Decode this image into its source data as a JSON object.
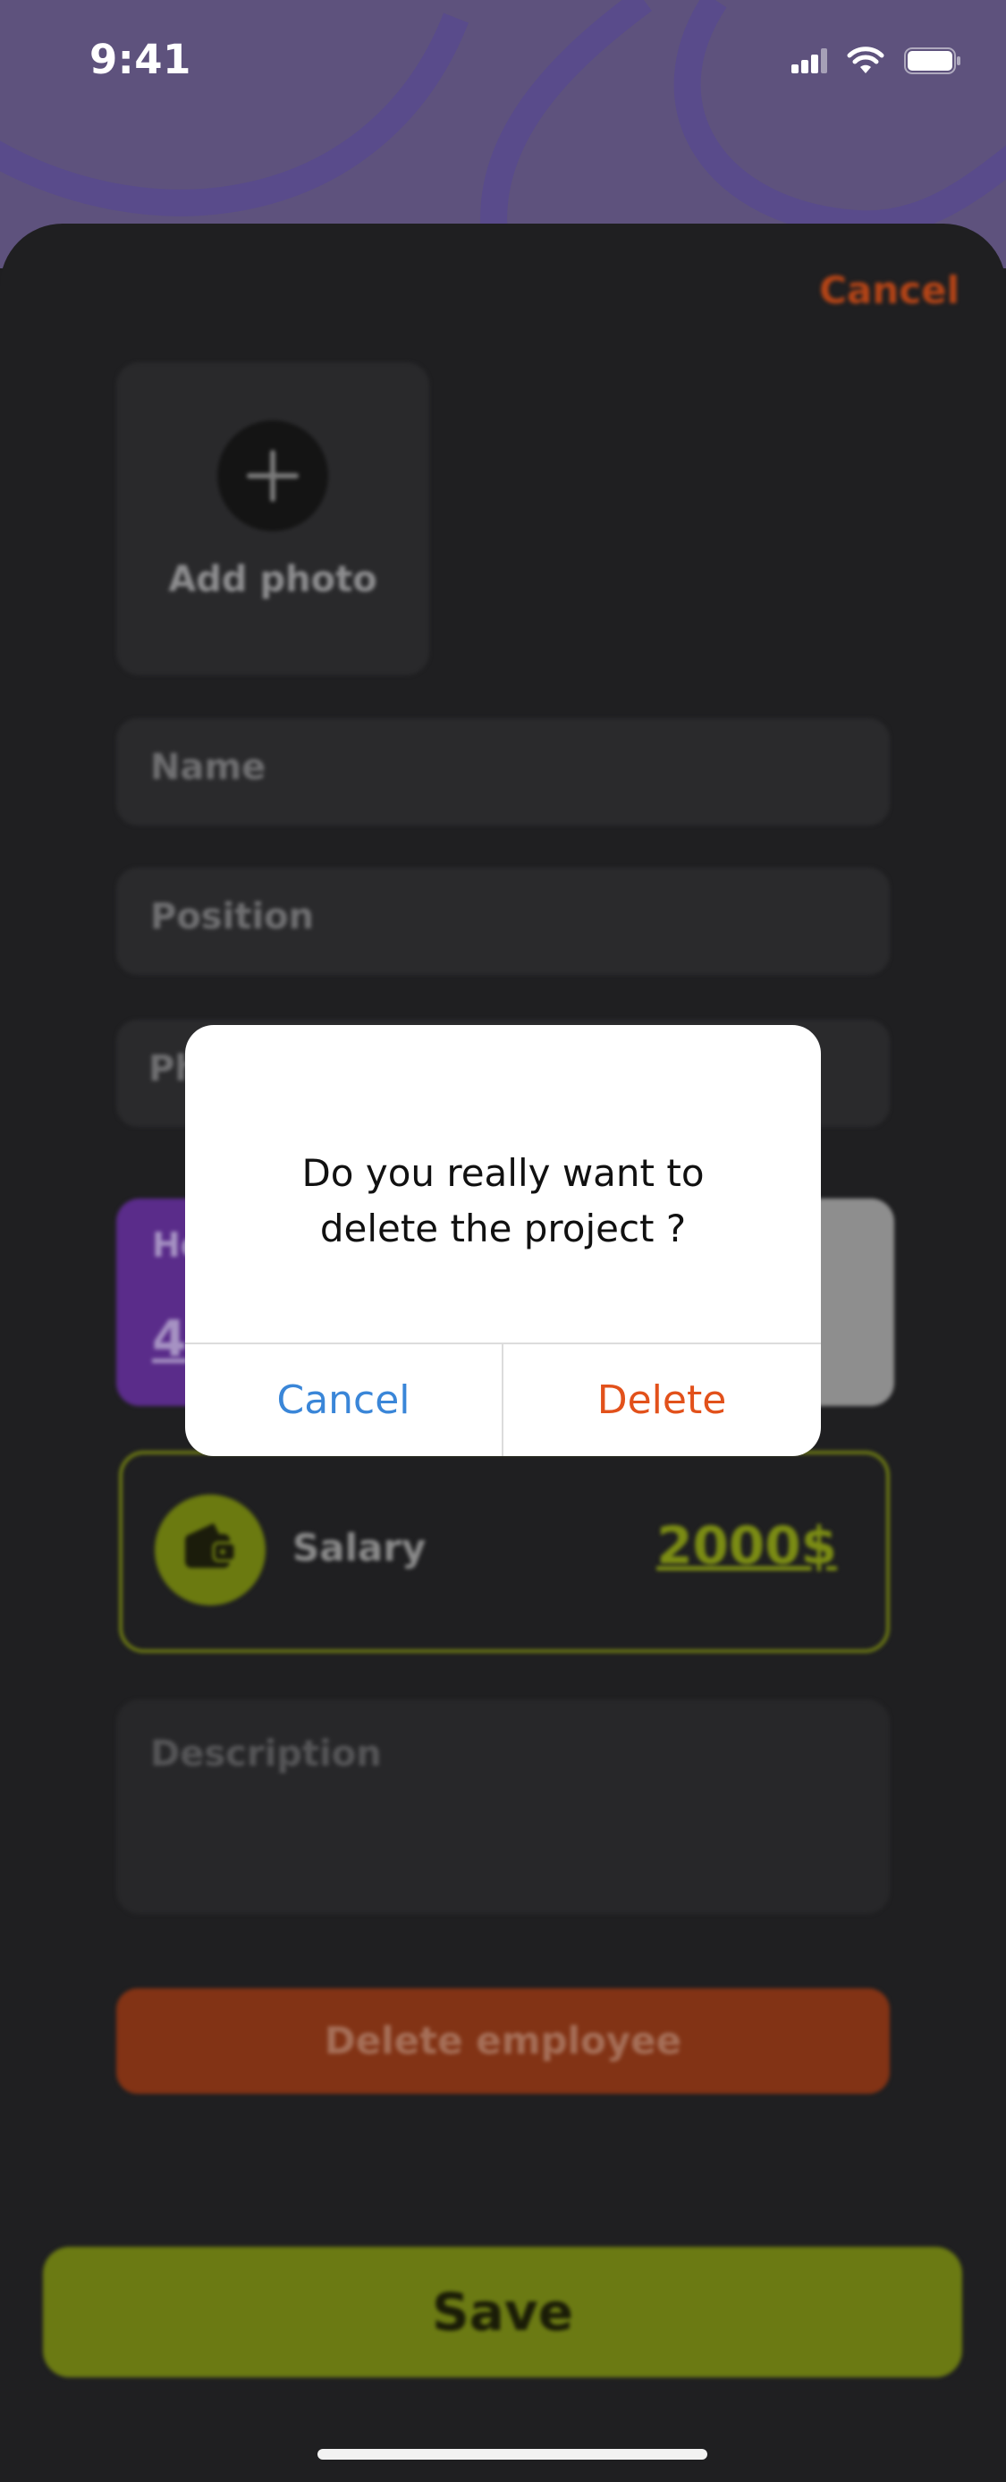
{
  "status_bar": {
    "time": "9:41"
  },
  "header": {
    "cancel_label": "Cancel"
  },
  "form": {
    "add_photo_label": "Add photo",
    "name_placeholder": "Name",
    "position_placeholder": "Position",
    "phone_placeholder": "Ph",
    "hours_label": "He",
    "hours_value": "4",
    "salary_label": "Salary",
    "salary_value": "2000$",
    "description_placeholder": "Description",
    "delete_employee_label": "Delete employee",
    "save_label": "Save"
  },
  "dialog": {
    "message_line1": "Do you really want to",
    "message_line2": "delete the project ?",
    "cancel_label": "Cancel",
    "delete_label": "Delete"
  },
  "colors": {
    "accent_green": "#6b7a13",
    "accent_orange": "#e2511b",
    "accent_blue": "#3a86d8",
    "accent_purple": "#5a2c8a",
    "header_bg": "#5e527d"
  },
  "icons": [
    "plus-icon",
    "wallet-icon",
    "signal-icon",
    "wifi-icon",
    "battery-icon"
  ]
}
